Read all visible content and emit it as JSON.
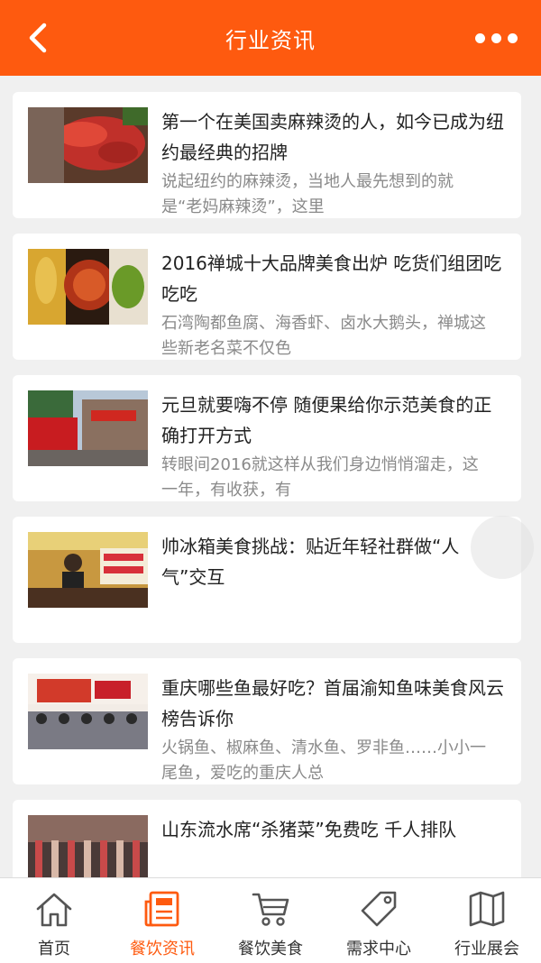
{
  "header": {
    "title": "行业资讯",
    "back_icon": "chevron-left-icon",
    "more_icon": "more-dots-icon"
  },
  "articles": [
    {
      "title": "第一个在美国卖麻辣烫的人，如今已成为纽约最经典的招牌",
      "desc": "说起纽约的麻辣烫，当地人最先想到的就是“老妈麻辣烫”，这里"
    },
    {
      "title": "2016禅城十大品牌美食出炉 吃货们组团吃吃吃",
      "desc": "石湾陶都鱼腐、海香虾、卤水大鹅头，禅城这些新老名菜不仅色"
    },
    {
      "title": "元旦就要嗨不停 随便果给你示范美食的正确打开方式",
      "desc": "转眼间2016就这样从我们身边悄悄溜走，这一年，有收获，有"
    },
    {
      "title": "帅冰箱美食挑战：贴近年轻社群做“人气”交互",
      "desc": ""
    },
    {
      "title": "重庆哪些鱼最好吃？首届渝知鱼味美食风云榜告诉你",
      "desc": "火锅鱼、椒麻鱼、清水鱼、罗非鱼……小小一尾鱼，爱吃的重庆人总"
    },
    {
      "title": "山东流水席“杀猪菜”免费吃 千人排队",
      "desc": ""
    }
  ],
  "tabbar": {
    "active_color": "#fe5a0f",
    "items": [
      {
        "label": "首页",
        "icon": "home-icon"
      },
      {
        "label": "餐饮资讯",
        "icon": "news-icon"
      },
      {
        "label": "餐饮美食",
        "icon": "cart-icon"
      },
      {
        "label": "需求中心",
        "icon": "tag-icon"
      },
      {
        "label": "行业展会",
        "icon": "map-icon"
      }
    ]
  }
}
